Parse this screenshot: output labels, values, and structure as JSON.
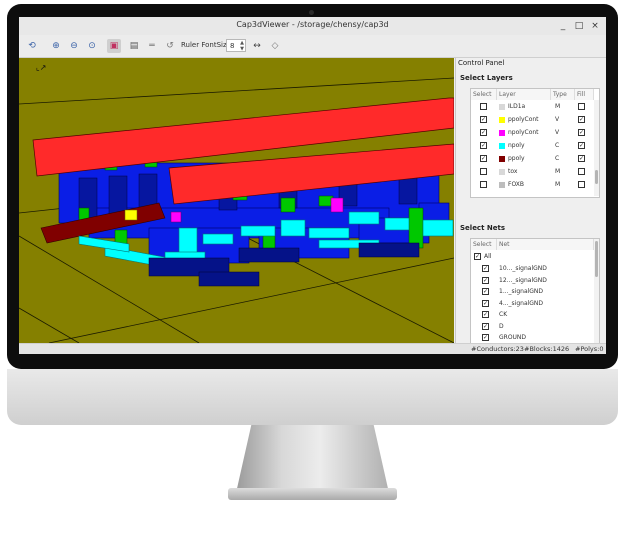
{
  "window": {
    "title": "Cap3dViewer - /storage/chensy/cap3d",
    "minimize": "_",
    "maximize": "□",
    "close": "×"
  },
  "toolbar": {
    "ruler_fontsize_label": "Ruler FontSize",
    "ruler_fontsize_value": "8",
    "icons": [
      "open-icon",
      "zoom-in-icon",
      "zoom-out-icon",
      "zoom-fit-icon",
      "layers-icon",
      "clipboard-icon",
      "ruler-icon",
      "rotate-icon",
      "measure-icon",
      "eraser-icon"
    ]
  },
  "control_panel": {
    "title": "Control Panel",
    "layers_title": "Select Layers",
    "layer_headers": {
      "select": "Select",
      "layer": "Layer",
      "type": "Type",
      "fill": "Fill"
    },
    "layers": [
      {
        "name": "ILD1a",
        "type": "M",
        "color": "#d8d8d8",
        "selected": false,
        "fill": false
      },
      {
        "name": "ppolyCont",
        "type": "V",
        "color": "#ffff00",
        "selected": true,
        "fill": true
      },
      {
        "name": "npolyCont",
        "type": "V",
        "color": "#ff00ff",
        "selected": true,
        "fill": true
      },
      {
        "name": "npoly",
        "type": "C",
        "color": "#00ffff",
        "selected": true,
        "fill": true
      },
      {
        "name": "ppoly",
        "type": "C",
        "color": "#800000",
        "selected": true,
        "fill": true
      },
      {
        "name": "tox",
        "type": "M",
        "color": "#d8d8d8",
        "selected": false,
        "fill": false
      },
      {
        "name": "FOXB",
        "type": "M",
        "color": "#bdbdbd",
        "selected": false,
        "fill": false
      }
    ],
    "nets_title": "Select Nets",
    "net_headers": {
      "select": "Select",
      "net": "Net"
    },
    "all_label": "All",
    "nets": [
      "10..._signalGND",
      "12..._signalGND",
      "1..._signalGND",
      "4..._signalGND",
      "CK",
      "D",
      "GROUND"
    ]
  },
  "status": {
    "conductors": "#Conductors:23",
    "blocks": "#Blocks:1426",
    "polys": "#Polys:0"
  },
  "colors": {
    "viewport_bg": "#858000",
    "red": "#ff2a2a",
    "blue": "#0a1ee6",
    "cyan": "#00ffff",
    "green": "#00c800"
  }
}
